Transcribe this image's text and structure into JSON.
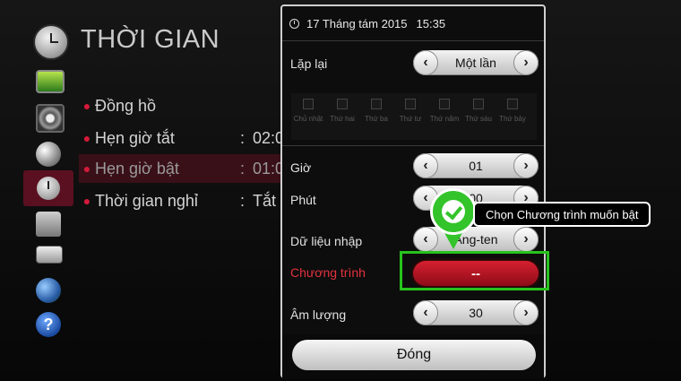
{
  "settings_menu": {
    "title": "THỜI GIAN",
    "items": [
      {
        "label": "Đồng hồ",
        "value": ""
      },
      {
        "label": "Hẹn giờ tắt",
        "value": "02:0"
      },
      {
        "label": "Hẹn giờ bật",
        "value": "01:0"
      },
      {
        "label": "Thời gian nghỉ",
        "value": "Tắt"
      }
    ],
    "selected_index": 2,
    "categories": [
      "picture-icon",
      "sound-icon",
      "channel-icon",
      "time-icon",
      "lock-icon",
      "option-icon",
      "network-icon",
      "support-icon"
    ]
  },
  "popup": {
    "date": "17 Tháng tám 2015",
    "time": "15:35",
    "repeat": {
      "label": "Lặp lại",
      "value": "Một lần"
    },
    "days": [
      "Chủ nhật",
      "Thứ hai",
      "Thứ ba",
      "Thứ tư",
      "Thứ năm",
      "Thứ sáu",
      "Thứ bảy"
    ],
    "hour": {
      "label": "Giờ",
      "value": "01"
    },
    "minute": {
      "label": "Phút",
      "value": "00"
    },
    "input": {
      "label": "Dữ liệu nhập",
      "value": "Ăng-ten"
    },
    "program": {
      "label": "Chương trình",
      "value": "--"
    },
    "volume": {
      "label": "Âm lượng",
      "value": "30"
    },
    "close_label": "Đóng"
  },
  "annotation": {
    "text": "Chọn Chương trình muốn bật"
  },
  "colors": {
    "accent_red": "#d41a3a",
    "highlight_green": "#27c31d"
  }
}
